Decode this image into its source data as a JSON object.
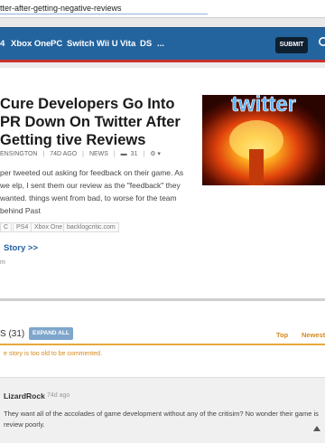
{
  "browser": {
    "url": "tter-after-getting-negative-reviews"
  },
  "nav": {
    "items": [
      "4",
      "Xbox One",
      "PC",
      "Switch",
      "Wii U",
      "Vita",
      "DS",
      "..."
    ],
    "submit_label": "SUBMIT"
  },
  "article": {
    "title": "Cure Developers Go Into PR Down On Twitter After Getting tive Reviews",
    "author": "ENSINGTON",
    "age": "74D AGO",
    "category": "NEWS",
    "comment_count": "31",
    "excerpt": "per tweeted out asking for feedback on their game. As we elp, I sent them our review as the \"feedback\" they wanted. things went from bad, to worse for the team behind Past",
    "tags": [
      "C",
      "PS4",
      "Xbox One",
      "backlogcritic.com"
    ],
    "story_link": "Story >>",
    "source": "m",
    "image_text": "twitter"
  },
  "comments": {
    "header": "S (31)",
    "expand_label": "EXPAND ALL",
    "sort_top": "Top",
    "sort_newest": "Newest",
    "notice": "e story is too old to be commented.",
    "items": [
      {
        "user": "LizardRock",
        "time": "74d ago",
        "text": "They want all of the accolades of game development without any of the critisim? No wonder their game is review poorly."
      }
    ]
  },
  "colors": {
    "nav": "#24649e",
    "accent_red": "#c8312c",
    "link": "#2560a2",
    "orange": "#d4891d"
  }
}
